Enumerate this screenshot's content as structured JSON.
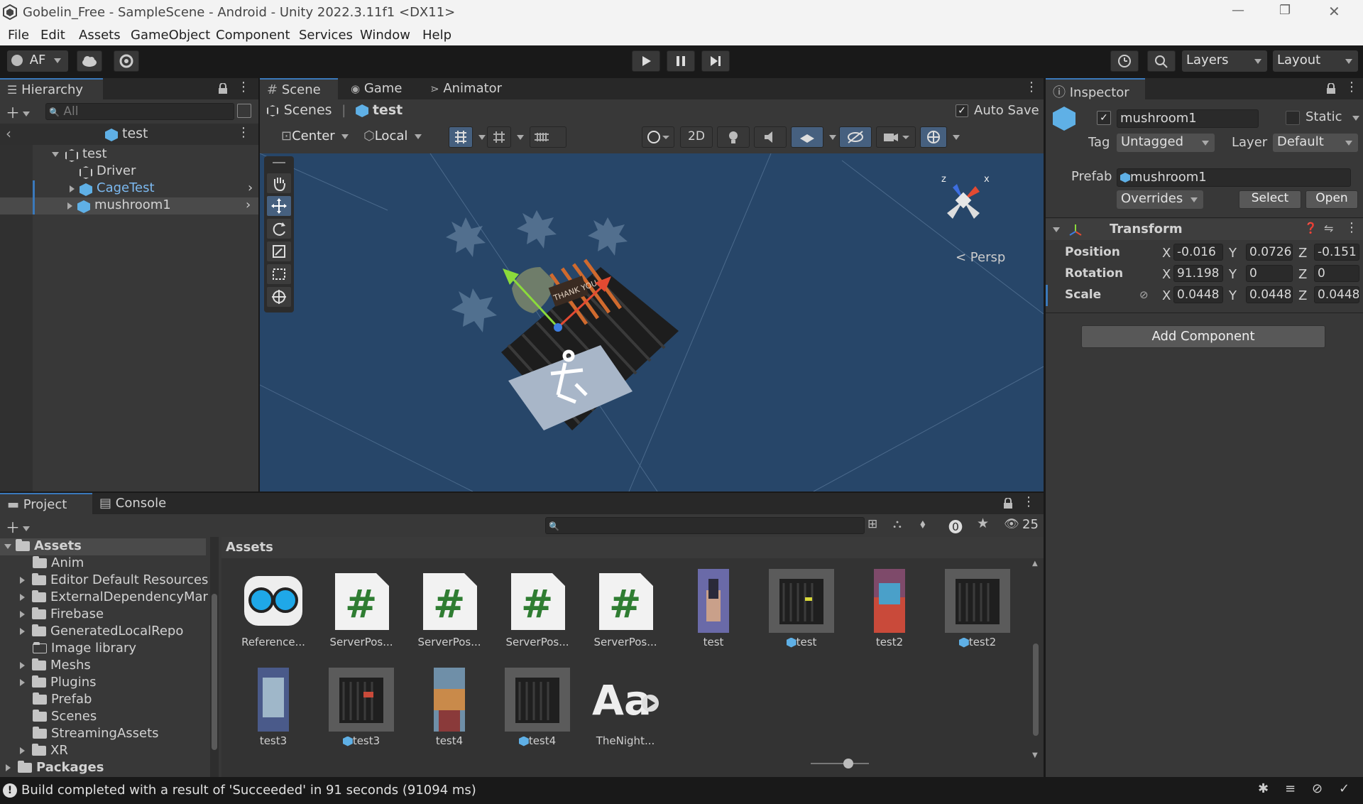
{
  "window": {
    "title": "Gobelin_Free - SampleScene - Android - Unity 2022.3.11f1 <DX11>",
    "minimize": "—",
    "maximize": "❐",
    "close": "✕"
  },
  "menu": [
    "File",
    "Edit",
    "Assets",
    "GameObject",
    "Component",
    "Services",
    "Window",
    "Help"
  ],
  "toolbar": {
    "account": "AF",
    "layers": "Layers",
    "layout": "Layout"
  },
  "hierarchy": {
    "tab": "Hierarchy",
    "search_placeholder": "All",
    "scene_header": "test",
    "items": [
      {
        "label": "test"
      },
      {
        "label": "Driver"
      },
      {
        "label": "CageTest"
      },
      {
        "label": "mushroom1"
      }
    ]
  },
  "scene": {
    "tabs": [
      "Scene",
      "Game",
      "Animator"
    ],
    "breadcrumb_root": "Scenes",
    "breadcrumb_current": "test",
    "auto_save": "Auto Save",
    "pivot": "Center",
    "space": "Local",
    "mode_2d": "2D",
    "persp": "< Persp",
    "gizmo_z": "z",
    "gizmo_x": "x",
    "sign_text": "THANK YOU"
  },
  "inspector": {
    "tab": "Inspector",
    "name": "mushroom1",
    "static": "Static",
    "tag_label": "Tag",
    "tag_value": "Untagged",
    "layer_label": "Layer",
    "layer_value": "Default",
    "prefab_label": "Prefab",
    "prefab_value": "mushroom1",
    "overrides": "Overrides",
    "select": "Select",
    "open": "Open",
    "transform": {
      "title": "Transform",
      "position": {
        "label": "Position",
        "x": "-0.016",
        "y": "0.0726",
        "z": "-0.151"
      },
      "rotation": {
        "label": "Rotation",
        "x": "91.198",
        "y": "0",
        "z": "0"
      },
      "scale": {
        "label": "Scale",
        "x": "0.0448",
        "y": "0.0448",
        "z": "0.0448"
      },
      "axis_x": "X",
      "axis_y": "Y",
      "axis_z": "Z"
    },
    "add_component": "Add Component"
  },
  "project": {
    "tabs": [
      "Project",
      "Console"
    ],
    "hidden_count": "25",
    "assets_title": "Assets",
    "tree": [
      {
        "label": "Assets"
      },
      {
        "label": "Anim"
      },
      {
        "label": "Editor Default Resources"
      },
      {
        "label": "ExternalDependencyMar"
      },
      {
        "label": "Firebase"
      },
      {
        "label": "GeneratedLocalRepo"
      },
      {
        "label": "Image library"
      },
      {
        "label": "Meshs"
      },
      {
        "label": "Plugins"
      },
      {
        "label": "Prefab"
      },
      {
        "label": "Scenes"
      },
      {
        "label": "StreamingAssets"
      },
      {
        "label": "XR"
      },
      {
        "label": "Packages"
      }
    ],
    "assets": [
      {
        "name": "Reference...",
        "kind": "vr-icon"
      },
      {
        "name": "ServerPos...",
        "kind": "script-icon"
      },
      {
        "name": "ServerPos...",
        "kind": "script-icon"
      },
      {
        "name": "ServerPos...",
        "kind": "script-icon"
      },
      {
        "name": "ServerPos...",
        "kind": "script-icon"
      },
      {
        "name": "test",
        "kind": "image"
      },
      {
        "name": "test",
        "kind": "prefab"
      },
      {
        "name": "test2",
        "kind": "image"
      },
      {
        "name": "test2",
        "kind": "prefab"
      },
      {
        "name": "test3",
        "kind": "image"
      },
      {
        "name": "test3",
        "kind": "prefab"
      },
      {
        "name": "test4",
        "kind": "image"
      },
      {
        "name": "test4",
        "kind": "prefab"
      },
      {
        "name": "TheNight...",
        "kind": "font"
      }
    ],
    "font_glyph": "Aa",
    "script_glyph": "#"
  },
  "status": {
    "message": "Build completed with a result of 'Succeeded' in 91 seconds (91094 ms)"
  },
  "colors": {
    "accent": "#3a79bb",
    "panel": "#383838",
    "scene_bg": "#274669"
  }
}
